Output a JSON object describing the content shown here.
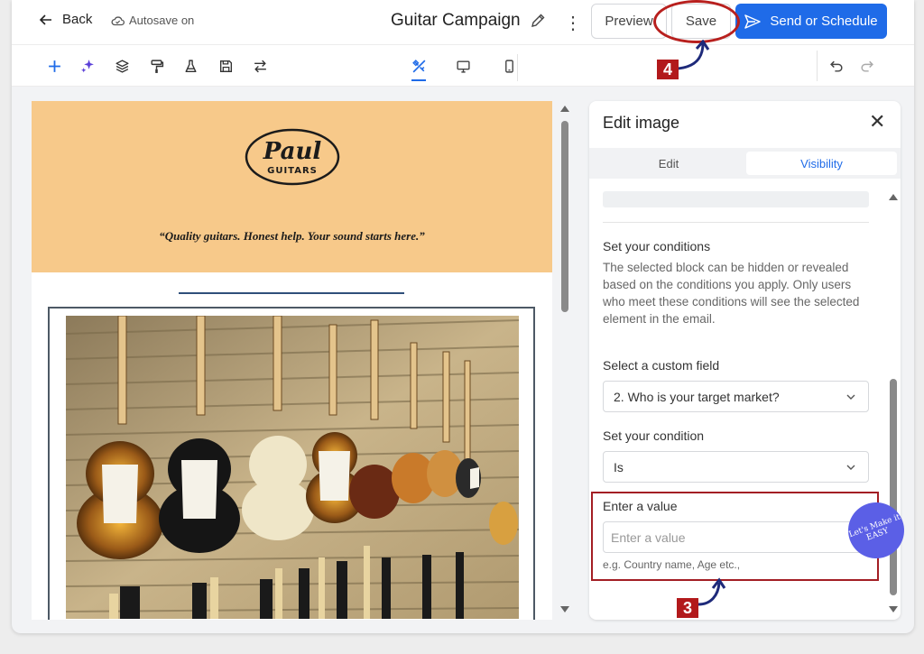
{
  "header": {
    "back_label": "Back",
    "autosave_label": "Autosave on",
    "campaign_title": "Guitar Campaign",
    "preview_label": "Preview",
    "save_label": "Save",
    "send_label": "Send or Schedule"
  },
  "email": {
    "logo_line1": "Paul",
    "logo_line2": "GUITARS",
    "tagline": "“Quality guitars. Honest help. Your sound starts here.”",
    "header_color": "#f7c98a"
  },
  "panel": {
    "title": "Edit image",
    "tabs": [
      {
        "label": "Edit",
        "active": false
      },
      {
        "label": "Visibility",
        "active": true
      }
    ],
    "conditions_heading": "Set your conditions",
    "conditions_desc": "The selected block can be hidden or revealed based on the conditions you apply. Only users who meet these conditions will see the selected element in the email.",
    "custom_field_label": "Select a custom field",
    "custom_field_value": "2. Who is your target market?",
    "condition_label": "Set your condition",
    "condition_value": "Is",
    "value_label": "Enter a value",
    "value_placeholder": "Enter a value",
    "value_hint": "e.g. Country name, Age etc.,"
  },
  "annotations": {
    "step_save": "4",
    "step_value": "3",
    "watermark": "Let's Make it EASY"
  },
  "colors": {
    "accent": "#1f6be8",
    "annotation": "#b2191b"
  }
}
